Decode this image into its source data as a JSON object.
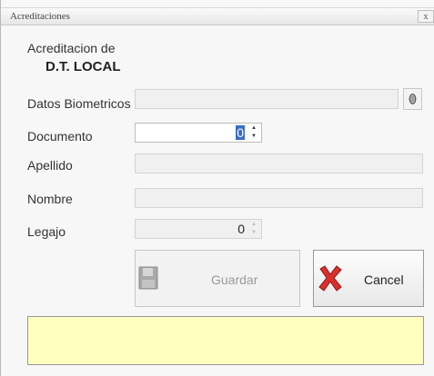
{
  "window": {
    "title": "Acreditaciones",
    "close_label": "x"
  },
  "header": {
    "label": "Acreditacion de",
    "location": "D.T. LOCAL"
  },
  "form": {
    "biometric_label": "Datos Biometricos",
    "document_label": "Documento",
    "document_value": "0",
    "lastname_label": "Apellido",
    "lastname_value": "",
    "name_label": "Nombre",
    "name_value": "",
    "legajo_label": "Legajo",
    "legajo_value": "0"
  },
  "buttons": {
    "save_label": "Guardar",
    "cancel_label": "Cancel"
  },
  "status_message": "",
  "colors": {
    "message_background": "#ffffc0",
    "selection": "#3b6fc4",
    "cancel_icon": "#d9302c"
  },
  "icons": {
    "fingerprint": "fingerprint-icon",
    "save": "floppy-disk-icon",
    "cancel": "red-x-icon"
  }
}
